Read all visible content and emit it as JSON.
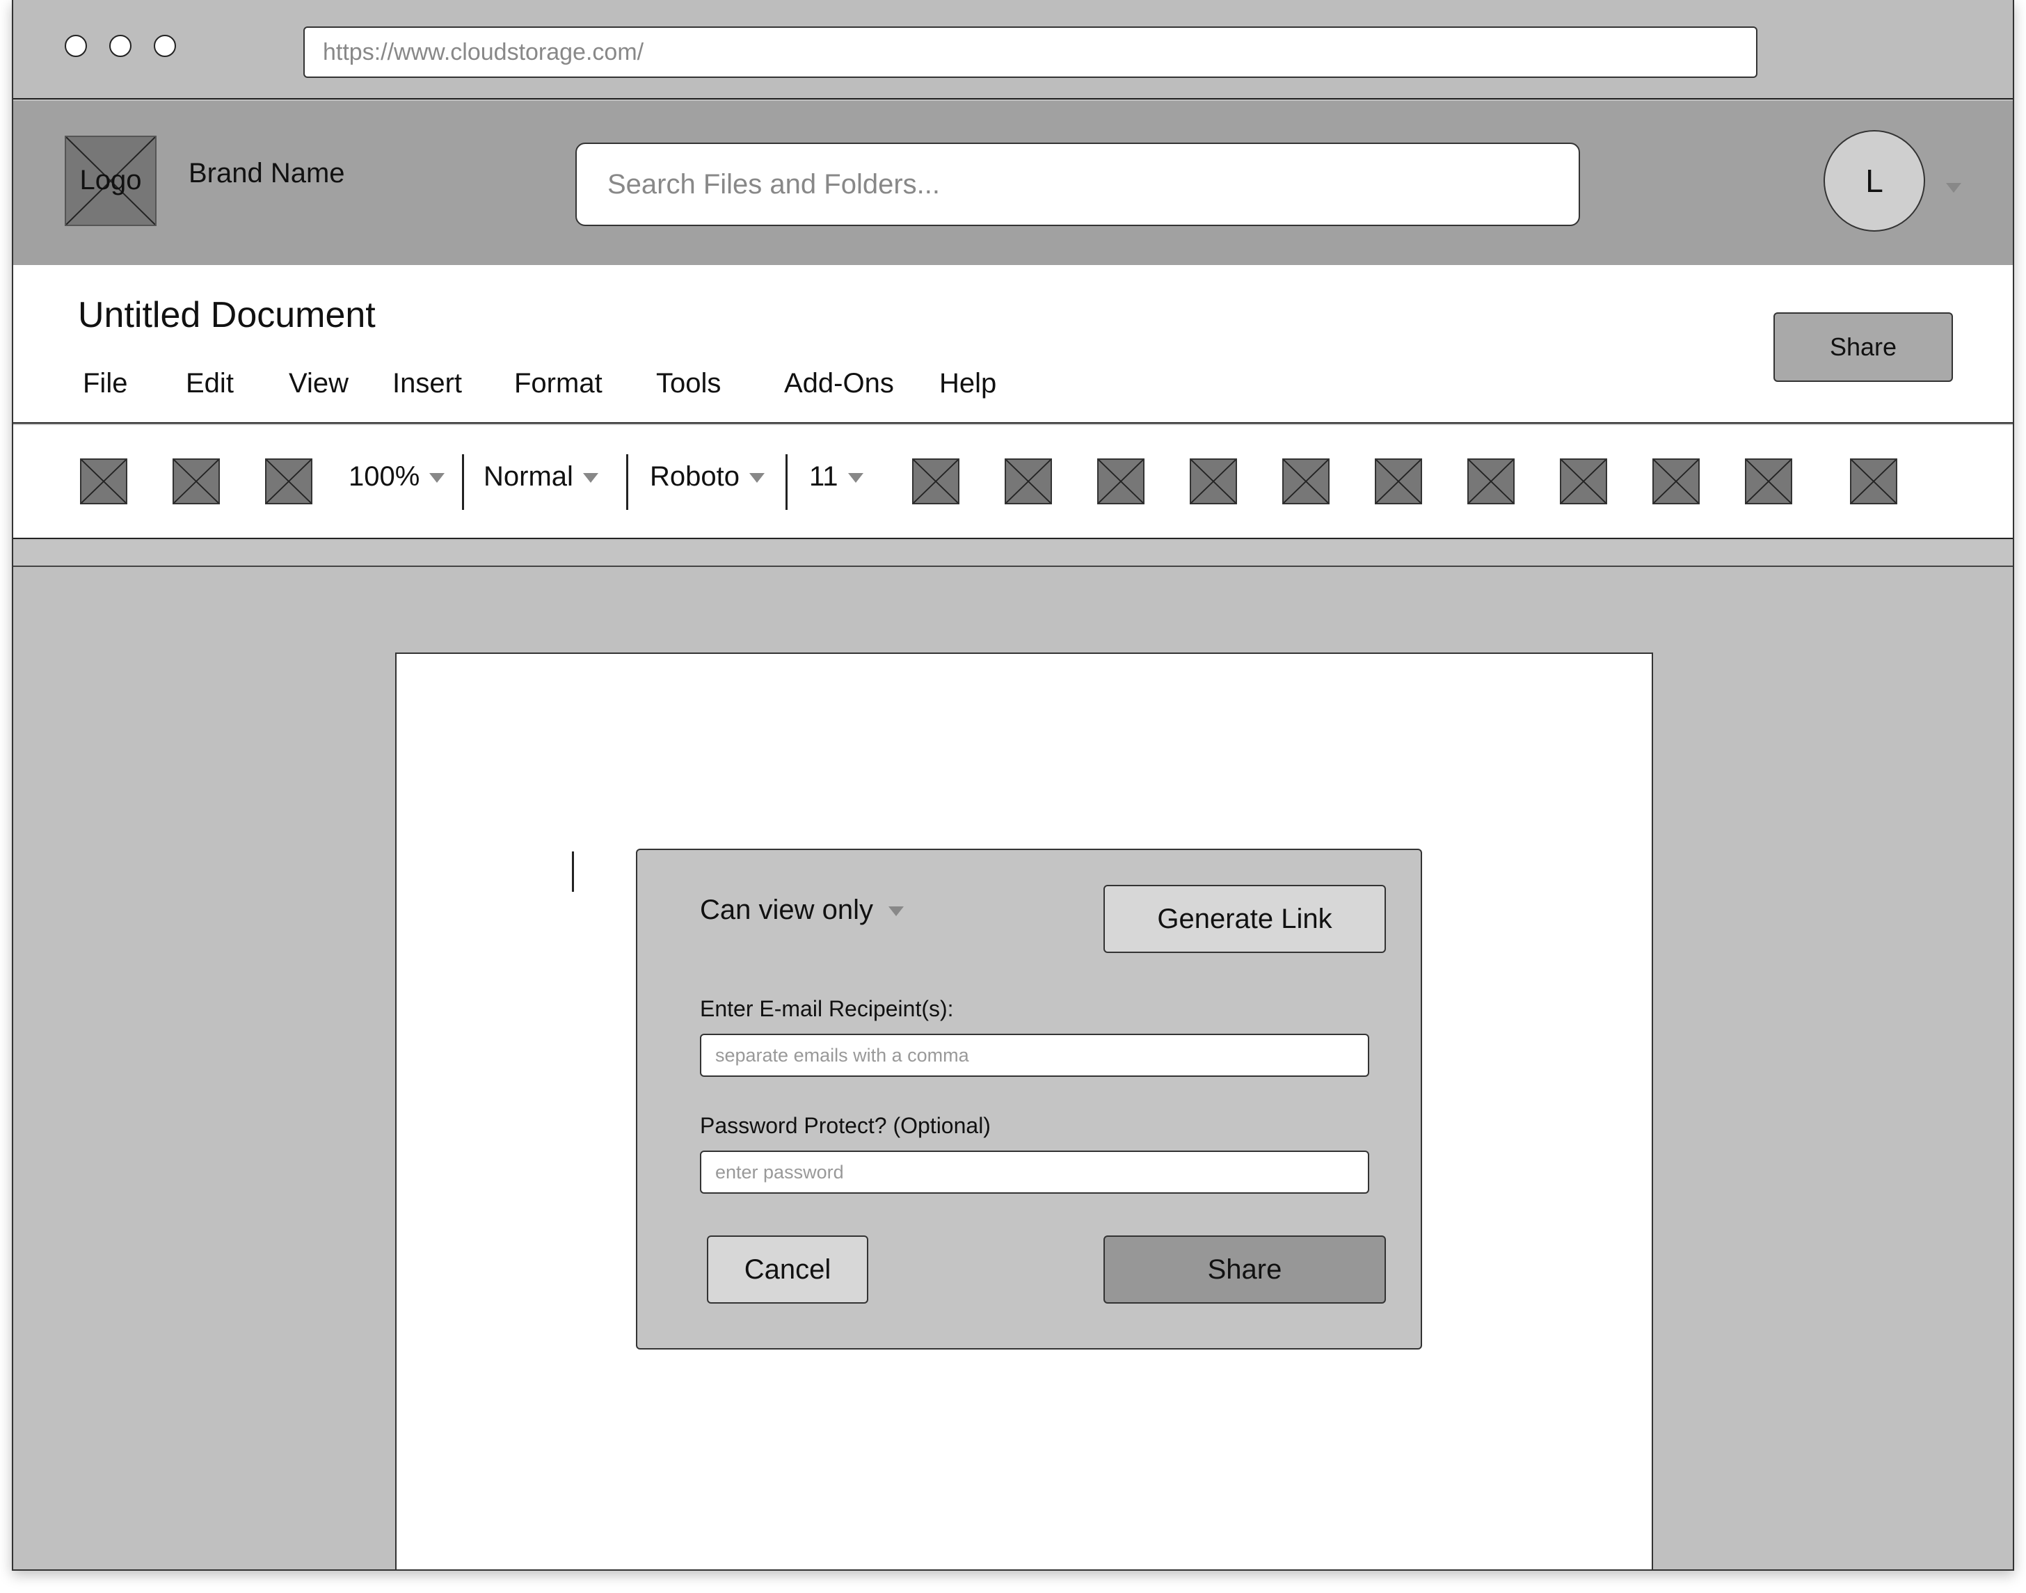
{
  "browser": {
    "url": "https://www.cloudstorage.com/"
  },
  "header": {
    "logo_text": "Logo",
    "brand_name": "Brand Name",
    "search_placeholder": "Search Files and Folders...",
    "avatar_initial": "L"
  },
  "document": {
    "title": "Untitled Document",
    "share_label": "Share",
    "menu": [
      "File",
      "Edit",
      "View",
      "Insert",
      "Format",
      "Tools",
      "Add-Ons",
      "Help"
    ]
  },
  "toolbar": {
    "zoom": "100%",
    "style": "Normal",
    "font": "Roboto",
    "size": "11"
  },
  "share_dialog": {
    "permission": "Can view only",
    "generate_link_label": "Generate Link",
    "email_label": "Enter E-mail Recipeint(s):",
    "email_placeholder": "separate emails with a comma",
    "password_label": "Password Protect? (Optional)",
    "password_placeholder": "enter password",
    "cancel_label": "Cancel",
    "share_label": "Share"
  },
  "colors": {
    "chrome": "#bdbdbd",
    "header": "#a1a1a1",
    "canvas": "#c0c0c0",
    "placeholder_icon": "#777777"
  }
}
